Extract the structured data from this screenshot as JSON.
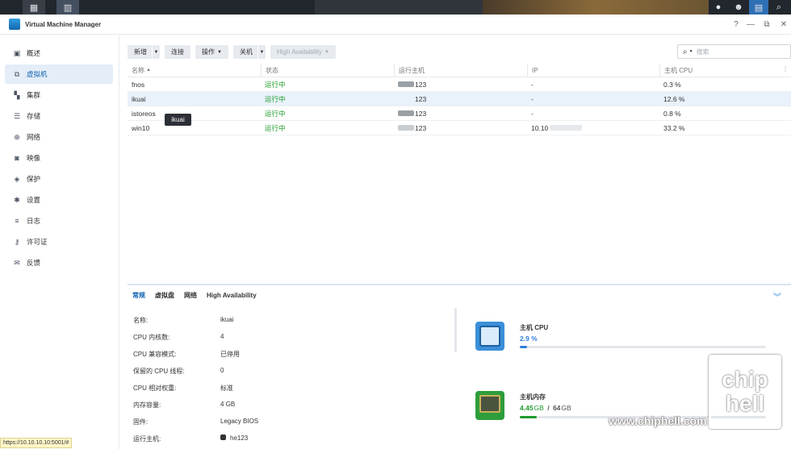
{
  "window": {
    "title": "Virtual Machine Manager"
  },
  "sidebar": {
    "items": [
      {
        "label": "概述",
        "icon": "overview-icon"
      },
      {
        "label": "虚拟机",
        "icon": "vm-icon"
      },
      {
        "label": "集群",
        "icon": "cluster-icon"
      },
      {
        "label": "存储",
        "icon": "storage-icon"
      },
      {
        "label": "网络",
        "icon": "network-icon"
      },
      {
        "label": "映像",
        "icon": "image-icon"
      },
      {
        "label": "保护",
        "icon": "shield-icon"
      },
      {
        "label": "设置",
        "icon": "gear-icon"
      },
      {
        "label": "日志",
        "icon": "list-icon"
      },
      {
        "label": "许可证",
        "icon": "key-icon"
      },
      {
        "label": "反馈",
        "icon": "mail-icon"
      }
    ]
  },
  "toolbar": {
    "new": "新增",
    "connect": "连接",
    "action": "操作",
    "shutdown": "关机",
    "ha": "High Availability"
  },
  "search": {
    "placeholder": "搜索"
  },
  "grid": {
    "columns": [
      "名称",
      "状态",
      "运行主机",
      "IP",
      "主机 CPU"
    ],
    "rows": [
      {
        "name": "fnos",
        "status": "运行中",
        "host": "123",
        "ip": "-",
        "cpu": "0.3 %"
      },
      {
        "name": "ikuai",
        "status": "运行中",
        "host": "123",
        "ip": "-",
        "cpu": "12.6 %"
      },
      {
        "name": "istoreos",
        "status": "运行中",
        "host": "123",
        "ip": "-",
        "cpu": "0.8 %"
      },
      {
        "name": "win10",
        "status": "运行中",
        "host": "123",
        "ip": "10.10",
        "cpu": "33.2 %"
      }
    ]
  },
  "tooltip": "ikuai",
  "panel": {
    "tabs": [
      "常规",
      "虚拟盘",
      "网络",
      "High Availability"
    ],
    "details": [
      {
        "k": "名称:",
        "v": "ikuai"
      },
      {
        "k": "CPU 内核数:",
        "v": "4"
      },
      {
        "k": "CPU 兼容模式:",
        "v": "已停用"
      },
      {
        "k": "保留的 CPU 线程:",
        "v": "0"
      },
      {
        "k": "CPU 相对权重:",
        "v": "标准"
      },
      {
        "k": "内存容量:",
        "v": "4 GB"
      },
      {
        "k": "固件:",
        "v": "Legacy BIOS"
      },
      {
        "k": "运行主机:",
        "v": "he123"
      }
    ],
    "cpu": {
      "title": "主机 CPU",
      "value": "2.9 %",
      "percent": 2.9,
      "color": "#2f7fd8"
    },
    "mem": {
      "title": "主机内存",
      "used": "4.45",
      "used_unit": "GB",
      "sep": "/",
      "total": "64",
      "total_unit": "GB",
      "percent": 7,
      "color": "#1f9a2e"
    }
  },
  "watermark": {
    "url": "www.chiphell.com",
    "logo": "chip hell"
  },
  "statusbar": {
    "url": "https://10.10.10.10:5001/#"
  }
}
